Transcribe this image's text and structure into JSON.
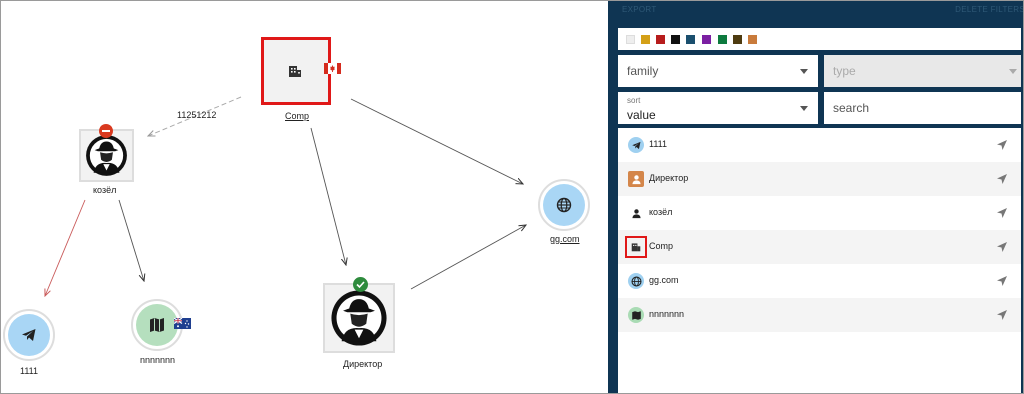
{
  "graph": {
    "edge_label": "11251212",
    "nodes": {
      "comp": {
        "label": "Comp",
        "flag": "canada"
      },
      "kozel": {
        "label": "козёл",
        "badge": "minus"
      },
      "gg": {
        "label": "gg.com"
      },
      "direktor": {
        "label": "Директор",
        "badge": "check"
      },
      "tg": {
        "label": "1111"
      },
      "map": {
        "label": "nnnnnnn",
        "flag": "australia"
      }
    }
  },
  "panel": {
    "export_label": "EXPORT",
    "delete_label": "DELETE FILTERS",
    "palette": [
      "#eeeeee",
      "#d4a017",
      "#b71c1c",
      "#111111",
      "#1a4f6e",
      "#7b1fa2",
      "#0d7a3e",
      "#4e3b10",
      "#c97b3b"
    ],
    "filters": {
      "family": {
        "value": "family"
      },
      "type": {
        "placeholder": "type"
      },
      "sort": {
        "label": "sort",
        "value": "value"
      },
      "search": {
        "placeholder": "search"
      }
    },
    "items": [
      {
        "label": "1111",
        "icon": "telegram-icon"
      },
      {
        "label": "Директор",
        "icon": "person-icon"
      },
      {
        "label": "козёл",
        "icon": "person-icon"
      },
      {
        "label": "Comp",
        "icon": "building-icon"
      },
      {
        "label": "gg.com",
        "icon": "globe-icon"
      },
      {
        "label": "nnnnnnn",
        "icon": "map-icon"
      }
    ]
  }
}
